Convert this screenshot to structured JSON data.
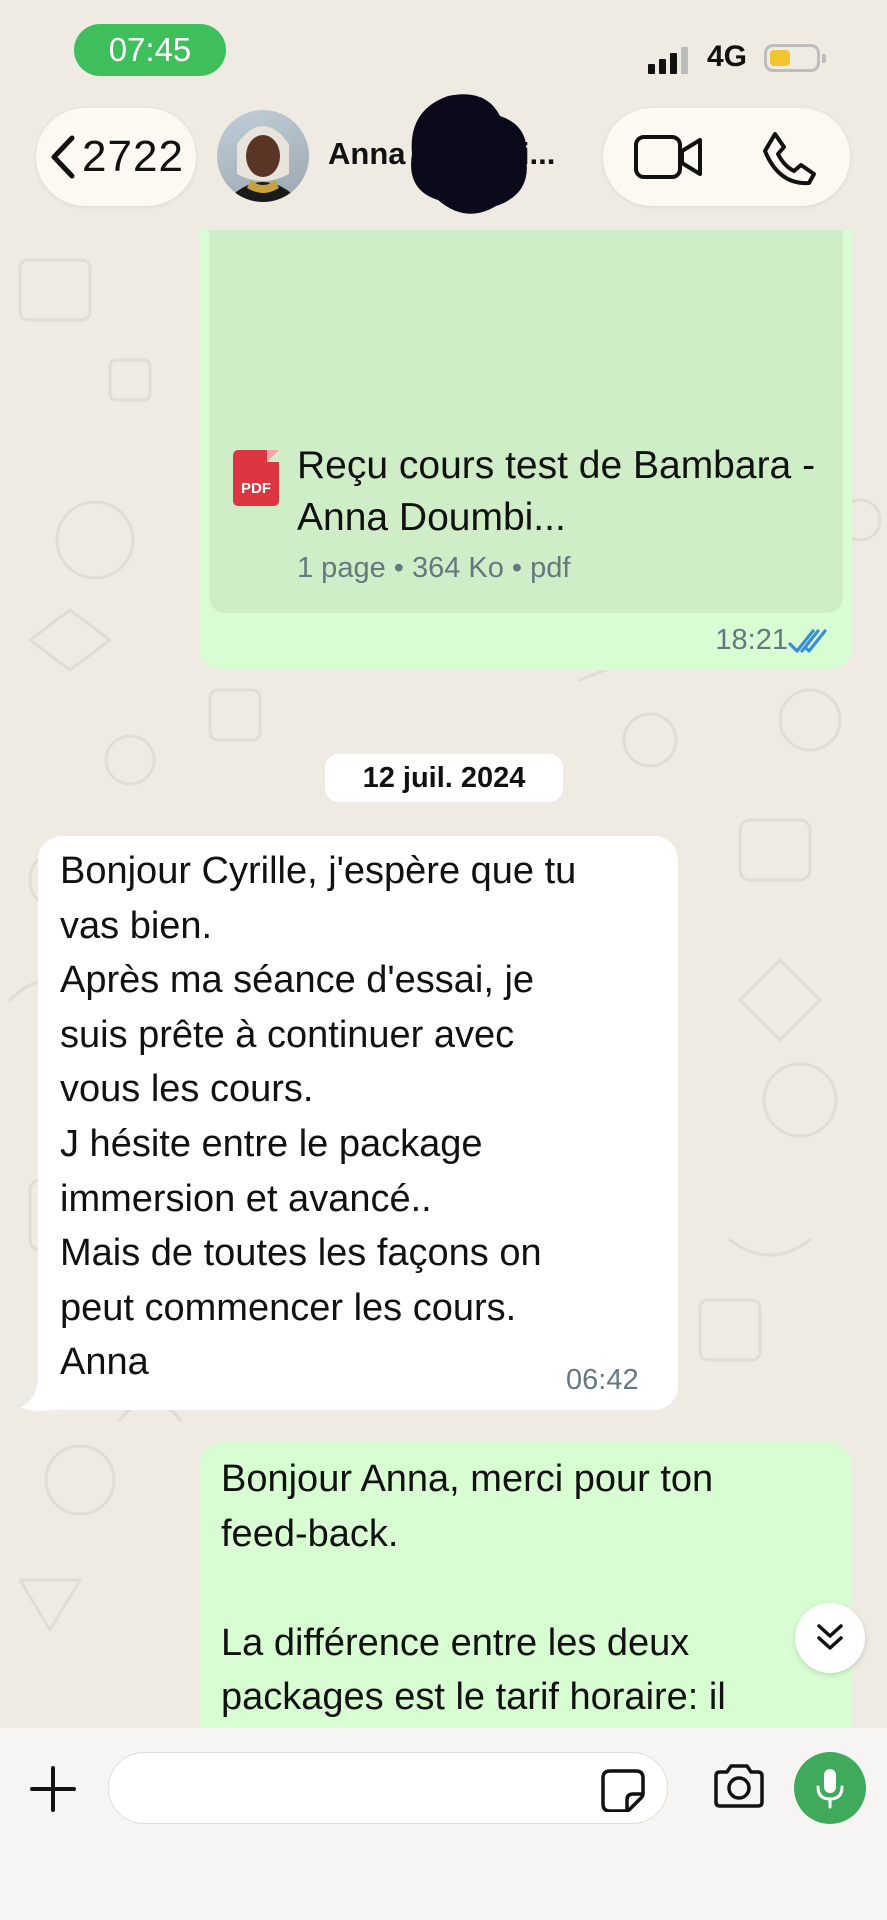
{
  "status_bar": {
    "time": "07:45",
    "network": "4G"
  },
  "header": {
    "back_count": "2722",
    "contact_name": "Anna Doumbi..."
  },
  "messages": {
    "document": {
      "title": "Reçu cours test de Bambara - Anna Doumbi...",
      "meta": "1 page • 364 Ko • pdf",
      "icon_label": "PDF",
      "time": "18:21"
    },
    "date_separator": "12 juil. 2024",
    "incoming": {
      "lines": [
        "Bonjour Cyrille, j'espère que tu",
        "vas bien.",
        "Après ma séance d'essai, je",
        "suis prête à continuer avec",
        "vous les cours.",
        "J hésite entre le package",
        "immersion et avancé..",
        "Mais de toutes les façons on",
        "peut commencer les cours.",
        "Anna"
      ],
      "time": "06:42"
    },
    "outgoing": {
      "lines": [
        "Bonjour Anna, merci pour ton",
        "feed-back.",
        "",
        "La différence entre les deux",
        "packages est le tarif horaire: il"
      ]
    }
  },
  "composer": {
    "placeholder": "",
    "value": ""
  },
  "colors": {
    "time_pill": "#3fbf5b",
    "outgoing_bubble": "#d9fdd3",
    "read_ticks": "#3b8ed6",
    "mic_button": "#3fa95c",
    "pdf_icon": "#dd3641"
  }
}
